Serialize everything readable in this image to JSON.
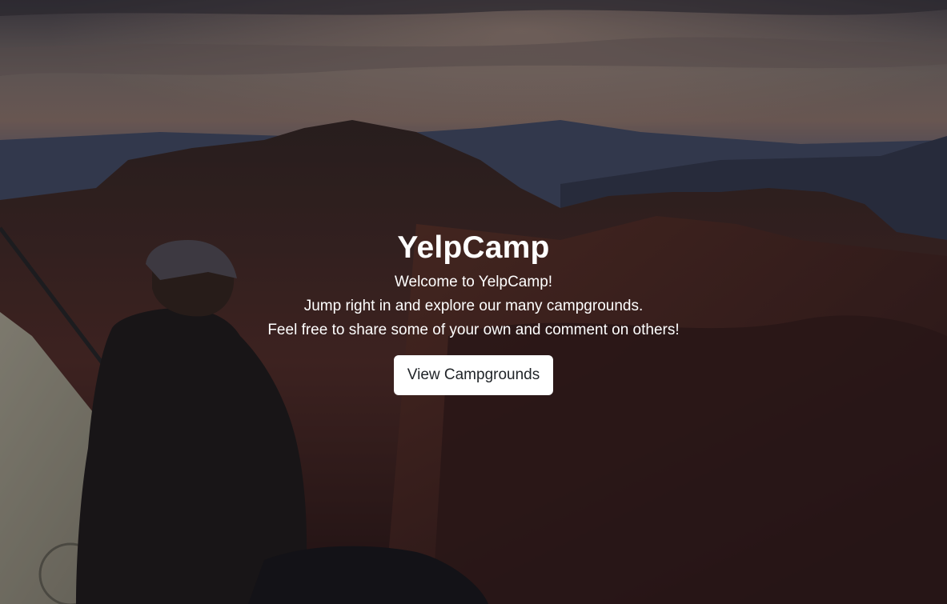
{
  "page": {
    "title": "YelpCamp",
    "lines": [
      "Welcome to YelpCamp!",
      "Jump right in and explore our many campgrounds.",
      "Feel free to share some of your own and comment on others!"
    ],
    "cta_label": "View Campgrounds"
  },
  "background": {
    "description_icon": "landscape-photo",
    "sky_color": "#6e6a78",
    "mountain_color": "#4a2a2a",
    "foreground_color": "#2a1818"
  }
}
